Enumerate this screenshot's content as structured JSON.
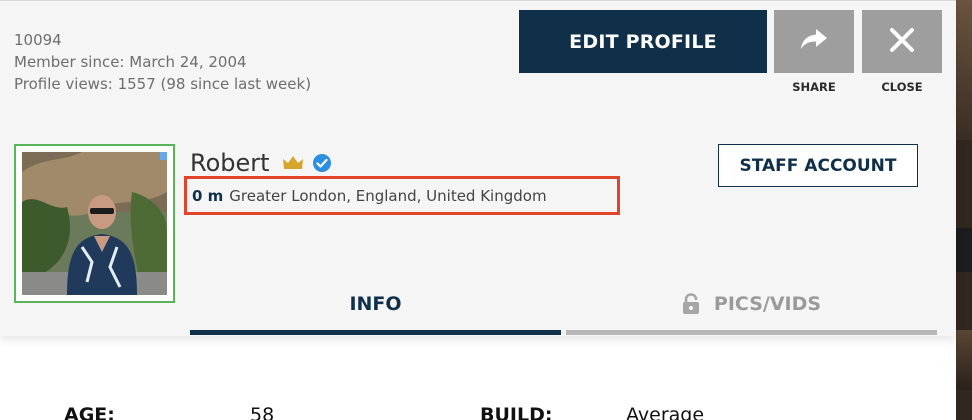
{
  "profile": {
    "id": "10094",
    "member_since": "Member since: March 24, 2004",
    "profile_views": "Profile views: 1557 (98 since last week)",
    "name": "Robert",
    "distance": "0 m",
    "location": "Greater London, England, United Kingdom",
    "badges": [
      "crown-icon",
      "verified-icon"
    ]
  },
  "actions": {
    "edit_label": "EDIT PROFILE",
    "share_label": "SHARE",
    "close_label": "CLOSE",
    "share_icon": "share-arrow-icon",
    "close_icon": "close-icon"
  },
  "staff_badge": "STAFF ACCOUNT",
  "tabs": [
    {
      "label": "INFO",
      "active": true
    },
    {
      "label": "PICS/VIDS",
      "active": false,
      "icon": "lock-icon"
    }
  ],
  "details": [
    {
      "label": "AGE:",
      "value": "58"
    },
    {
      "label": "BUILD:",
      "value": "Average"
    }
  ],
  "colors": {
    "primary": "#10304a",
    "highlight_box": "#e0442a",
    "avatar_border": "#5bb35a",
    "secondary_button": "#9e9e9e",
    "crown": "#d4a72c",
    "verified": "#2d8fe0"
  }
}
